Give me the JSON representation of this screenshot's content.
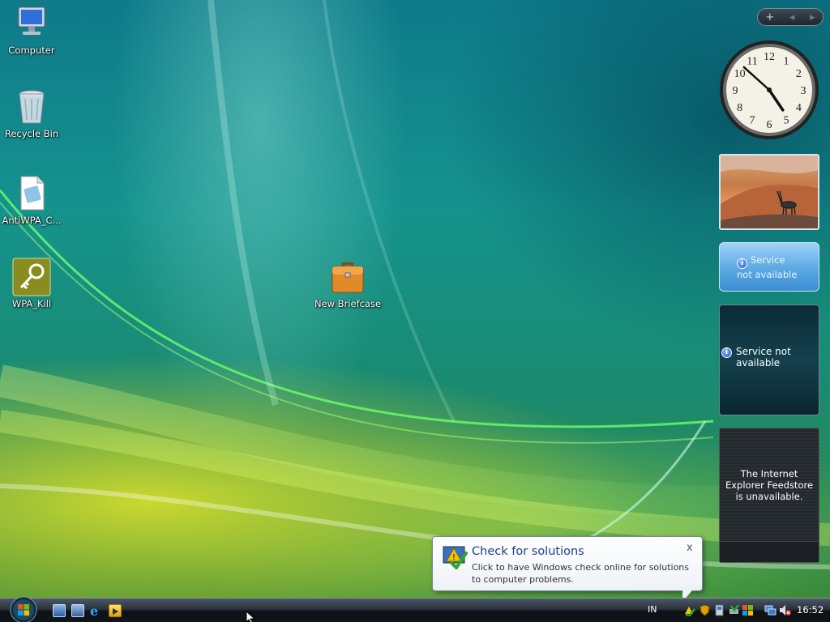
{
  "desktop_icons": [
    {
      "label": "Computer",
      "icon": "computer-icon"
    },
    {
      "label": "Recycle Bin",
      "icon": "recycle-bin-icon"
    },
    {
      "label": "AntiWPA_C...",
      "icon": "document-icon"
    },
    {
      "label": "WPA_Kill",
      "icon": "key-icon"
    },
    {
      "label": "New Briefcase",
      "icon": "briefcase-icon"
    }
  ],
  "sidebar": {
    "controls": {
      "add": "+",
      "prev": "◂",
      "next": "▸"
    },
    "clock": {
      "hour_numbers": [
        "12",
        "1",
        "2",
        "3",
        "4",
        "5",
        "6",
        "7",
        "8",
        "9",
        "10",
        "11"
      ],
      "hour": 4,
      "minute": 52
    },
    "weather_text": "Service not available",
    "stocks_text": "Service not available",
    "feeds_text": "The Internet Explorer Feedstore is unavailable."
  },
  "balloon": {
    "title": "Check for solutions",
    "message": "Click to have Windows check online for solutions to computer problems.",
    "close": "x"
  },
  "taskbar": {
    "language": "IN",
    "time": "16:52"
  },
  "colors": {
    "accent": "#1e3f8a",
    "taskbar": "#10151a"
  }
}
